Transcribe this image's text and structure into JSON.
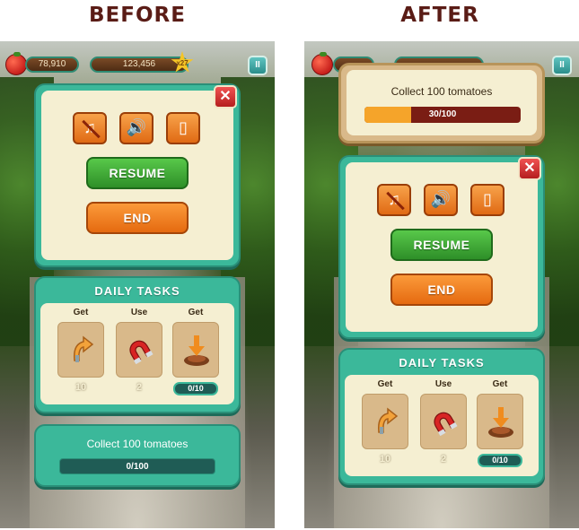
{
  "headings": {
    "before": "BEFORE",
    "after": "AFTER"
  },
  "hud": {
    "tomatoes": "78,910",
    "coins": "123,456",
    "multiplier": "x27"
  },
  "menu": {
    "close_symbol": "✕",
    "options": [
      {
        "icon": "music-off-icon",
        "glyph": "♫"
      },
      {
        "icon": "sound-on-icon",
        "glyph": "🔊"
      },
      {
        "icon": "vibration-icon",
        "glyph": "▯"
      }
    ],
    "resume_label": "RESUME",
    "end_label": "END"
  },
  "daily_tasks": {
    "title": "DAILY TASKS",
    "items": [
      {
        "label": "Get",
        "icon": "shovel-arrow-icon",
        "count": "10"
      },
      {
        "label": "Use",
        "icon": "magnet-icon",
        "count": "2"
      },
      {
        "label": "Get",
        "icon": "dig-spot-icon",
        "progress": "0/10"
      }
    ]
  },
  "goal_before": {
    "text": "Collect 100 tomatoes",
    "progress_label": "0/100",
    "progress": 0
  },
  "goal_after": {
    "text": "Collect 100 tomatoes",
    "progress_label": "30/100",
    "progress": 0.3
  },
  "colors": {
    "panel": "#3bb89a",
    "panel_inner": "#f5efd2",
    "resume": "#3ea934",
    "end": "#f07e22",
    "close": "#d53434",
    "heading": "#5a1c16",
    "progress_fill": "#f5a42a",
    "progress_track": "#7a1d14"
  }
}
